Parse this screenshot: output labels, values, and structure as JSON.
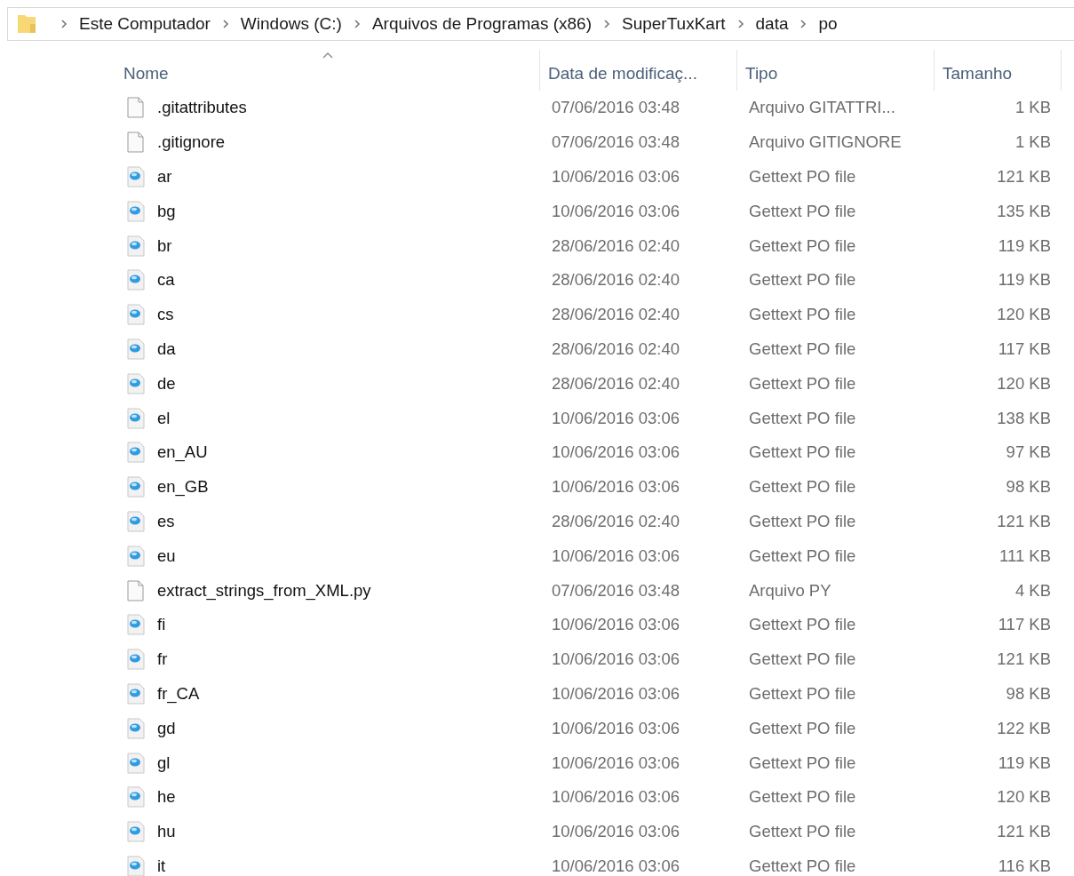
{
  "breadcrumb": [
    "Este Computador",
    "Windows (C:)",
    "Arquivos de Programas (x86)",
    "SuperTuxKart",
    "data",
    "po"
  ],
  "table": {
    "columns": [
      {
        "label": "Nome",
        "sorted": true
      },
      {
        "label": "Data de modificaç...",
        "sorted": false
      },
      {
        "label": "Tipo",
        "sorted": false
      },
      {
        "label": "Tamanho",
        "sorted": false
      }
    ],
    "rows": [
      {
        "kind": "blank",
        "name": ".gitattributes",
        "date": "07/06/2016 03:48",
        "type": "Arquivo GITATTRI...",
        "size": "1 KB"
      },
      {
        "kind": "blank",
        "name": ".gitignore",
        "date": "07/06/2016 03:48",
        "type": "Arquivo GITIGNORE",
        "size": "1 KB"
      },
      {
        "kind": "po",
        "name": "ar",
        "date": "10/06/2016 03:06",
        "type": "Gettext PO file",
        "size": "121 KB"
      },
      {
        "kind": "po",
        "name": "bg",
        "date": "10/06/2016 03:06",
        "type": "Gettext PO file",
        "size": "135 KB"
      },
      {
        "kind": "po",
        "name": "br",
        "date": "28/06/2016 02:40",
        "type": "Gettext PO file",
        "size": "119 KB"
      },
      {
        "kind": "po",
        "name": "ca",
        "date": "28/06/2016 02:40",
        "type": "Gettext PO file",
        "size": "119 KB"
      },
      {
        "kind": "po",
        "name": "cs",
        "date": "28/06/2016 02:40",
        "type": "Gettext PO file",
        "size": "120 KB"
      },
      {
        "kind": "po",
        "name": "da",
        "date": "28/06/2016 02:40",
        "type": "Gettext PO file",
        "size": "117 KB"
      },
      {
        "kind": "po",
        "name": "de",
        "date": "28/06/2016 02:40",
        "type": "Gettext PO file",
        "size": "120 KB"
      },
      {
        "kind": "po",
        "name": "el",
        "date": "10/06/2016 03:06",
        "type": "Gettext PO file",
        "size": "138 KB"
      },
      {
        "kind": "po",
        "name": "en_AU",
        "date": "10/06/2016 03:06",
        "type": "Gettext PO file",
        "size": "97 KB"
      },
      {
        "kind": "po",
        "name": "en_GB",
        "date": "10/06/2016 03:06",
        "type": "Gettext PO file",
        "size": "98 KB"
      },
      {
        "kind": "po",
        "name": "es",
        "date": "28/06/2016 02:40",
        "type": "Gettext PO file",
        "size": "121 KB"
      },
      {
        "kind": "po",
        "name": "eu",
        "date": "10/06/2016 03:06",
        "type": "Gettext PO file",
        "size": "111 KB"
      },
      {
        "kind": "blank",
        "name": "extract_strings_from_XML.py",
        "date": "07/06/2016 03:48",
        "type": "Arquivo PY",
        "size": "4 KB"
      },
      {
        "kind": "po",
        "name": "fi",
        "date": "10/06/2016 03:06",
        "type": "Gettext PO file",
        "size": "117 KB"
      },
      {
        "kind": "po",
        "name": "fr",
        "date": "10/06/2016 03:06",
        "type": "Gettext PO file",
        "size": "121 KB"
      },
      {
        "kind": "po",
        "name": "fr_CA",
        "date": "10/06/2016 03:06",
        "type": "Gettext PO file",
        "size": "98 KB"
      },
      {
        "kind": "po",
        "name": "gd",
        "date": "10/06/2016 03:06",
        "type": "Gettext PO file",
        "size": "122 KB"
      },
      {
        "kind": "po",
        "name": "gl",
        "date": "10/06/2016 03:06",
        "type": "Gettext PO file",
        "size": "119 KB"
      },
      {
        "kind": "po",
        "name": "he",
        "date": "10/06/2016 03:06",
        "type": "Gettext PO file",
        "size": "120 KB"
      },
      {
        "kind": "po",
        "name": "hu",
        "date": "10/06/2016 03:06",
        "type": "Gettext PO file",
        "size": "121 KB"
      },
      {
        "kind": "po",
        "name": "it",
        "date": "10/06/2016 03:06",
        "type": "Gettext PO file",
        "size": "116 KB"
      }
    ]
  }
}
